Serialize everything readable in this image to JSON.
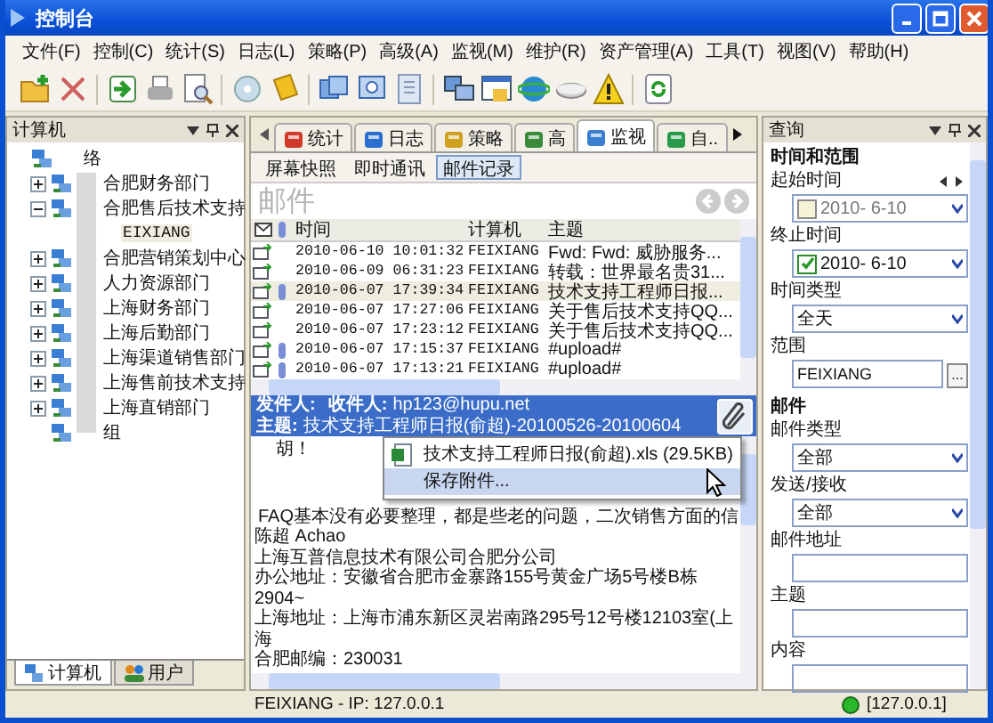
{
  "window": {
    "title": "控制台"
  },
  "menu": [
    "文件(F)",
    "控制(C)",
    "统计(S)",
    "日志(L)",
    "策略(P)",
    "高级(A)",
    "监视(M)",
    "维护(R)",
    "资产管理(A)",
    "工具(T)",
    "视图(V)",
    "帮助(H)"
  ],
  "left_pane": {
    "title": "计算机",
    "tree": {
      "label": "络",
      "kind": "group",
      "selected": false,
      "children": [
        {
          "label": "合肥财务部门",
          "kind": "group",
          "selected": false,
          "expanded": false
        },
        {
          "label": "合肥售后技术支持",
          "kind": "group",
          "selected": false,
          "expanded": true,
          "children": [
            {
              "label": "EIXIANG",
              "kind": "computer",
              "selected": true
            }
          ]
        },
        {
          "label": "合肥营销策划中心",
          "kind": "group",
          "selected": false,
          "expanded": false
        },
        {
          "label": "人力资源部门",
          "kind": "group",
          "selected": false,
          "expanded": false
        },
        {
          "label": "上海财务部门",
          "kind": "group",
          "selected": false,
          "expanded": false
        },
        {
          "label": "上海后勤部门",
          "kind": "group",
          "selected": false,
          "expanded": false
        },
        {
          "label": "上海渠道销售部门",
          "kind": "group",
          "selected": false,
          "expanded": false
        },
        {
          "label": "上海售前技术支持",
          "kind": "group",
          "selected": false,
          "expanded": false
        },
        {
          "label": "上海直销部门",
          "kind": "group",
          "selected": false,
          "expanded": false
        },
        {
          "label": "组",
          "kind": "group",
          "selected": false
        }
      ]
    },
    "bottom_tabs": [
      {
        "label": "计算机",
        "selected": true
      },
      {
        "label": "用户",
        "selected": false
      }
    ]
  },
  "center": {
    "tabs": [
      {
        "label": "统计",
        "selected": false
      },
      {
        "label": "日志",
        "selected": false
      },
      {
        "label": "策略",
        "selected": false
      },
      {
        "label": "高",
        "selected": false
      },
      {
        "label": "监视",
        "selected": true
      },
      {
        "label": "自..",
        "selected": false
      }
    ],
    "sub_tabs": [
      {
        "label": "屏幕快照",
        "selected": false
      },
      {
        "label": "即时通讯",
        "selected": false
      },
      {
        "label": "邮件记录",
        "selected": true
      }
    ],
    "heading": "邮件",
    "table": {
      "columns": [
        "时间",
        "计算机",
        "主题"
      ],
      "rows": [
        {
          "attachment": false,
          "time": "2010-06-10 10:01:32",
          "computer": "FEIXIANG",
          "subject": "Fwd: Fwd: 威胁服务...",
          "selected": false
        },
        {
          "attachment": false,
          "time": "2010-06-09 06:31:23",
          "computer": "FEIXIANG",
          "subject": "转载：世界最名贵31...",
          "selected": false
        },
        {
          "attachment": true,
          "time": "2010-06-07 17:39:34",
          "computer": "FEIXIANG",
          "subject": "技术支持工程师日报...",
          "selected": true
        },
        {
          "attachment": false,
          "time": "2010-06-07 17:27:06",
          "computer": "FEIXIANG",
          "subject": "关于售后技术支持QQ...",
          "selected": false
        },
        {
          "attachment": false,
          "time": "2010-06-07 17:23:12",
          "computer": "FEIXIANG",
          "subject": "关于售后技术支持QQ...",
          "selected": false
        },
        {
          "attachment": true,
          "time": "2010-06-07 17:15:37",
          "computer": "FEIXIANG",
          "subject": "#upload#",
          "selected": false
        },
        {
          "attachment": true,
          "time": "2010-06-07 17:13:21",
          "computer": "FEIXIANG",
          "subject": "#upload#",
          "selected": false
        }
      ]
    },
    "mail": {
      "from_label": "发件人:",
      "to_label": "收件人:",
      "to": "hp123@hupu.net",
      "subject_label": "主题:",
      "subject": "技术支持工程师日报(俞超)-20100526-20100604",
      "body": [
        "胡！",
        "FAQ基本没有必要整理，都是些老的问题，二次销售方面的信",
        "陈超 Achao",
        "上海互普信息技术有限公司合肥分公司",
        "办公地址：安徽省合肥市金寨路155号黄金广场5号楼B栋2904~",
        "上海地址：上海市浦东新区灵岩南路295号12号楼12103室(上海",
        "合肥邮编：230031"
      ],
      "popup": [
        {
          "kind": "file",
          "label": "技术支持工程师日报(俞超).xls (29.5KB)",
          "selected": false
        },
        {
          "kind": "action",
          "label": "保存附件...",
          "selected": true
        }
      ]
    }
  },
  "right_pane": {
    "title": "查询",
    "items": [
      {
        "kind": "section",
        "label": "时间和范围"
      },
      {
        "kind": "navlabel",
        "label": "起始时间"
      },
      {
        "kind": "date",
        "checked": false,
        "value": "2010- 6-10"
      },
      {
        "kind": "label",
        "label": "终止时间"
      },
      {
        "kind": "date",
        "checked": true,
        "value": "2010- 6-10"
      },
      {
        "kind": "label",
        "label": "时间类型"
      },
      {
        "kind": "select",
        "value": "全天"
      },
      {
        "kind": "label",
        "label": "范围"
      },
      {
        "kind": "browse",
        "value": "FEIXIANG",
        "button": "..."
      },
      {
        "kind": "section",
        "label": "邮件"
      },
      {
        "kind": "label",
        "label": "邮件类型"
      },
      {
        "kind": "select",
        "value": "全部"
      },
      {
        "kind": "label",
        "label": "发送/接收"
      },
      {
        "kind": "select",
        "value": "全部"
      },
      {
        "kind": "label",
        "label": "邮件地址"
      },
      {
        "kind": "text"
      },
      {
        "kind": "label",
        "label": "主题"
      },
      {
        "kind": "text"
      },
      {
        "kind": "label",
        "label": "内容"
      },
      {
        "kind": "text"
      }
    ]
  },
  "status_bar": {
    "host": "FEIXIANG - IP: 127.0.0.1",
    "connection": "[127.0.0.1]"
  }
}
